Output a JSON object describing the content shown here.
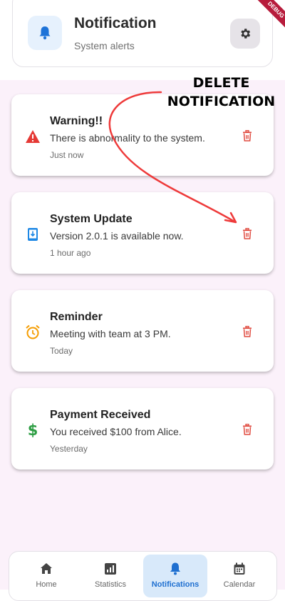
{
  "header": {
    "title": "Notification",
    "subtitle": "System alerts",
    "debug_label": "DEBUG"
  },
  "annotation": {
    "line1": "DELETE",
    "line2": "NOTIFICATION"
  },
  "notifications": [
    {
      "title": "Warning!!",
      "message": "There is abnormality to the system.",
      "time": "Just now",
      "icon": "warning-icon",
      "color": "#e53935"
    },
    {
      "title": "System Update",
      "message": "Version 2.0.1 is available now.",
      "time": "1 hour ago",
      "icon": "phone-update-icon",
      "color": "#1e88e5"
    },
    {
      "title": "Reminder",
      "message": "Meeting with team at 3 PM.",
      "time": "Today",
      "icon": "alarm-icon",
      "color": "#f59c00"
    },
    {
      "title": "Payment Received",
      "message": "You received $100 from Alice.",
      "time": "Yesterday",
      "icon": "dollar-icon",
      "color": "#2e9e44"
    }
  ],
  "nav": [
    {
      "label": "Home",
      "icon": "home-icon"
    },
    {
      "label": "Statistics",
      "icon": "statistics-icon"
    },
    {
      "label": "Notifications",
      "icon": "bell-icon",
      "active": true
    },
    {
      "label": "Calendar",
      "icon": "calendar-icon"
    }
  ],
  "colors": {
    "accent": "#1e6fd0",
    "delete": "#e04a3f",
    "annotation_arrow": "#ee3a3a"
  }
}
